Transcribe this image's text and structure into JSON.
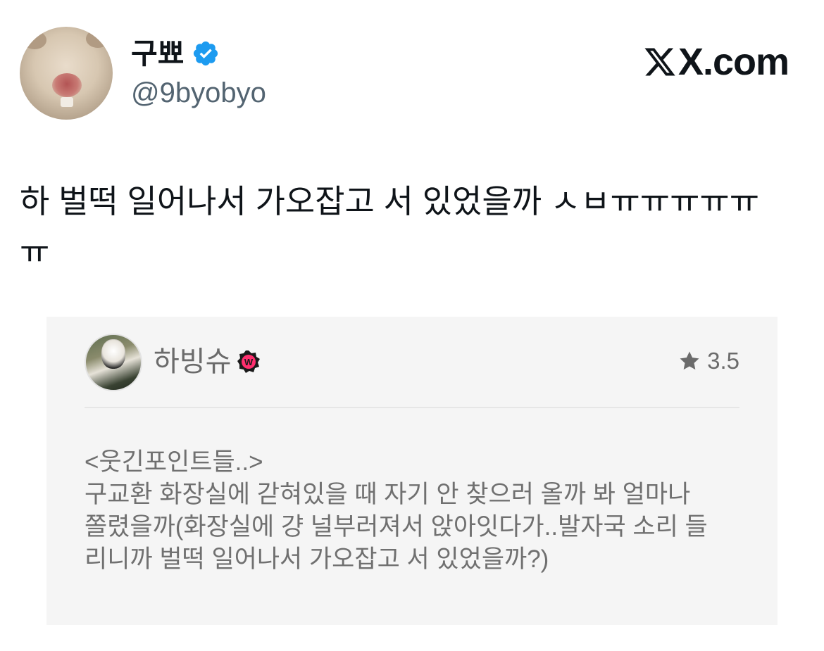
{
  "tweet": {
    "author": {
      "display_name": "구뾰",
      "handle": "@9byobyo",
      "verified": true,
      "avatar": "hamster-face-avatar"
    },
    "brand": "X.com",
    "text": "하 벌떡 일어나서 가오잡고 서 있었을까 ㅅㅂㅠㅠㅠㅠㅠ\nㅠ"
  },
  "quote": {
    "author_name": "하빙슈",
    "badge": "W",
    "rating": "3.5",
    "review_lines": [
      "<웃긴포인트들..>",
      "구교환 화장실에 갇혀있을 때 자기 안 찾으러 올까 봐 얼마나",
      "쫄렸을까(화장실에 걍 널부러져서 앉아잇다가..발자국 소리 들",
      "리니까 벌떡 일어나서 가오잡고 서 있었을까?)"
    ]
  },
  "colors": {
    "verified_blue": "#1d9bf0",
    "handle_gray": "#536471",
    "quote_bg": "#f5f5f5",
    "badge_pink": "#ff2e6e"
  }
}
